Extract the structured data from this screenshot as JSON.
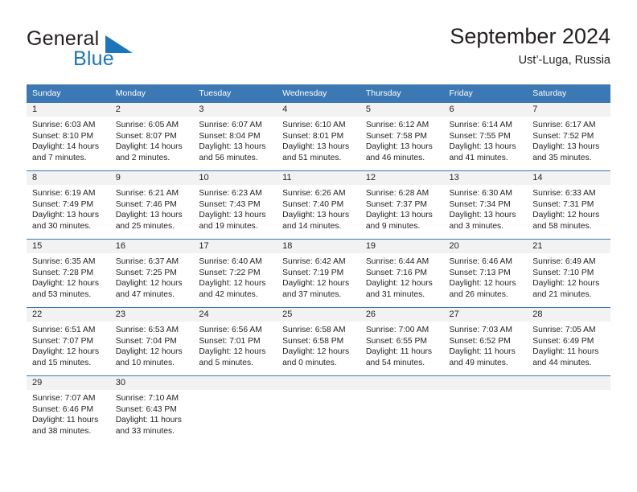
{
  "brand": {
    "name_dark": "General",
    "name_blue": "Blue",
    "flag_color": "#1b75bb"
  },
  "header": {
    "title": "September 2024",
    "subtitle": "Ust’-Luga, Russia"
  },
  "colors": {
    "header_row": "#3c78b4",
    "daynum_band": "#f2f2f2",
    "text": "#231f20",
    "brand_blue": "#1b75bb"
  },
  "weekday_headers": [
    "Sunday",
    "Monday",
    "Tuesday",
    "Wednesday",
    "Thursday",
    "Friday",
    "Saturday"
  ],
  "weeks": [
    [
      {
        "day": "1",
        "sunrise": "Sunrise: 6:03 AM",
        "sunset": "Sunset: 8:10 PM",
        "daylight_1": "Daylight: 14 hours",
        "daylight_2": "and 7 minutes."
      },
      {
        "day": "2",
        "sunrise": "Sunrise: 6:05 AM",
        "sunset": "Sunset: 8:07 PM",
        "daylight_1": "Daylight: 14 hours",
        "daylight_2": "and 2 minutes."
      },
      {
        "day": "3",
        "sunrise": "Sunrise: 6:07 AM",
        "sunset": "Sunset: 8:04 PM",
        "daylight_1": "Daylight: 13 hours",
        "daylight_2": "and 56 minutes."
      },
      {
        "day": "4",
        "sunrise": "Sunrise: 6:10 AM",
        "sunset": "Sunset: 8:01 PM",
        "daylight_1": "Daylight: 13 hours",
        "daylight_2": "and 51 minutes."
      },
      {
        "day": "5",
        "sunrise": "Sunrise: 6:12 AM",
        "sunset": "Sunset: 7:58 PM",
        "daylight_1": "Daylight: 13 hours",
        "daylight_2": "and 46 minutes."
      },
      {
        "day": "6",
        "sunrise": "Sunrise: 6:14 AM",
        "sunset": "Sunset: 7:55 PM",
        "daylight_1": "Daylight: 13 hours",
        "daylight_2": "and 41 minutes."
      },
      {
        "day": "7",
        "sunrise": "Sunrise: 6:17 AM",
        "sunset": "Sunset: 7:52 PM",
        "daylight_1": "Daylight: 13 hours",
        "daylight_2": "and 35 minutes."
      }
    ],
    [
      {
        "day": "8",
        "sunrise": "Sunrise: 6:19 AM",
        "sunset": "Sunset: 7:49 PM",
        "daylight_1": "Daylight: 13 hours",
        "daylight_2": "and 30 minutes."
      },
      {
        "day": "9",
        "sunrise": "Sunrise: 6:21 AM",
        "sunset": "Sunset: 7:46 PM",
        "daylight_1": "Daylight: 13 hours",
        "daylight_2": "and 25 minutes."
      },
      {
        "day": "10",
        "sunrise": "Sunrise: 6:23 AM",
        "sunset": "Sunset: 7:43 PM",
        "daylight_1": "Daylight: 13 hours",
        "daylight_2": "and 19 minutes."
      },
      {
        "day": "11",
        "sunrise": "Sunrise: 6:26 AM",
        "sunset": "Sunset: 7:40 PM",
        "daylight_1": "Daylight: 13 hours",
        "daylight_2": "and 14 minutes."
      },
      {
        "day": "12",
        "sunrise": "Sunrise: 6:28 AM",
        "sunset": "Sunset: 7:37 PM",
        "daylight_1": "Daylight: 13 hours",
        "daylight_2": "and 9 minutes."
      },
      {
        "day": "13",
        "sunrise": "Sunrise: 6:30 AM",
        "sunset": "Sunset: 7:34 PM",
        "daylight_1": "Daylight: 13 hours",
        "daylight_2": "and 3 minutes."
      },
      {
        "day": "14",
        "sunrise": "Sunrise: 6:33 AM",
        "sunset": "Sunset: 7:31 PM",
        "daylight_1": "Daylight: 12 hours",
        "daylight_2": "and 58 minutes."
      }
    ],
    [
      {
        "day": "15",
        "sunrise": "Sunrise: 6:35 AM",
        "sunset": "Sunset: 7:28 PM",
        "daylight_1": "Daylight: 12 hours",
        "daylight_2": "and 53 minutes."
      },
      {
        "day": "16",
        "sunrise": "Sunrise: 6:37 AM",
        "sunset": "Sunset: 7:25 PM",
        "daylight_1": "Daylight: 12 hours",
        "daylight_2": "and 47 minutes."
      },
      {
        "day": "17",
        "sunrise": "Sunrise: 6:40 AM",
        "sunset": "Sunset: 7:22 PM",
        "daylight_1": "Daylight: 12 hours",
        "daylight_2": "and 42 minutes."
      },
      {
        "day": "18",
        "sunrise": "Sunrise: 6:42 AM",
        "sunset": "Sunset: 7:19 PM",
        "daylight_1": "Daylight: 12 hours",
        "daylight_2": "and 37 minutes."
      },
      {
        "day": "19",
        "sunrise": "Sunrise: 6:44 AM",
        "sunset": "Sunset: 7:16 PM",
        "daylight_1": "Daylight: 12 hours",
        "daylight_2": "and 31 minutes."
      },
      {
        "day": "20",
        "sunrise": "Sunrise: 6:46 AM",
        "sunset": "Sunset: 7:13 PM",
        "daylight_1": "Daylight: 12 hours",
        "daylight_2": "and 26 minutes."
      },
      {
        "day": "21",
        "sunrise": "Sunrise: 6:49 AM",
        "sunset": "Sunset: 7:10 PM",
        "daylight_1": "Daylight: 12 hours",
        "daylight_2": "and 21 minutes."
      }
    ],
    [
      {
        "day": "22",
        "sunrise": "Sunrise: 6:51 AM",
        "sunset": "Sunset: 7:07 PM",
        "daylight_1": "Daylight: 12 hours",
        "daylight_2": "and 15 minutes."
      },
      {
        "day": "23",
        "sunrise": "Sunrise: 6:53 AM",
        "sunset": "Sunset: 7:04 PM",
        "daylight_1": "Daylight: 12 hours",
        "daylight_2": "and 10 minutes."
      },
      {
        "day": "24",
        "sunrise": "Sunrise: 6:56 AM",
        "sunset": "Sunset: 7:01 PM",
        "daylight_1": "Daylight: 12 hours",
        "daylight_2": "and 5 minutes."
      },
      {
        "day": "25",
        "sunrise": "Sunrise: 6:58 AM",
        "sunset": "Sunset: 6:58 PM",
        "daylight_1": "Daylight: 12 hours",
        "daylight_2": "and 0 minutes."
      },
      {
        "day": "26",
        "sunrise": "Sunrise: 7:00 AM",
        "sunset": "Sunset: 6:55 PM",
        "daylight_1": "Daylight: 11 hours",
        "daylight_2": "and 54 minutes."
      },
      {
        "day": "27",
        "sunrise": "Sunrise: 7:03 AM",
        "sunset": "Sunset: 6:52 PM",
        "daylight_1": "Daylight: 11 hours",
        "daylight_2": "and 49 minutes."
      },
      {
        "day": "28",
        "sunrise": "Sunrise: 7:05 AM",
        "sunset": "Sunset: 6:49 PM",
        "daylight_1": "Daylight: 11 hours",
        "daylight_2": "and 44 minutes."
      }
    ],
    [
      {
        "day": "29",
        "sunrise": "Sunrise: 7:07 AM",
        "sunset": "Sunset: 6:46 PM",
        "daylight_1": "Daylight: 11 hours",
        "daylight_2": "and 38 minutes."
      },
      {
        "day": "30",
        "sunrise": "Sunrise: 7:10 AM",
        "sunset": "Sunset: 6:43 PM",
        "daylight_1": "Daylight: 11 hours",
        "daylight_2": "and 33 minutes."
      },
      {
        "day": "",
        "sunrise": "",
        "sunset": "",
        "daylight_1": "",
        "daylight_2": ""
      },
      {
        "day": "",
        "sunrise": "",
        "sunset": "",
        "daylight_1": "",
        "daylight_2": ""
      },
      {
        "day": "",
        "sunrise": "",
        "sunset": "",
        "daylight_1": "",
        "daylight_2": ""
      },
      {
        "day": "",
        "sunrise": "",
        "sunset": "",
        "daylight_1": "",
        "daylight_2": ""
      },
      {
        "day": "",
        "sunrise": "",
        "sunset": "",
        "daylight_1": "",
        "daylight_2": ""
      }
    ]
  ]
}
